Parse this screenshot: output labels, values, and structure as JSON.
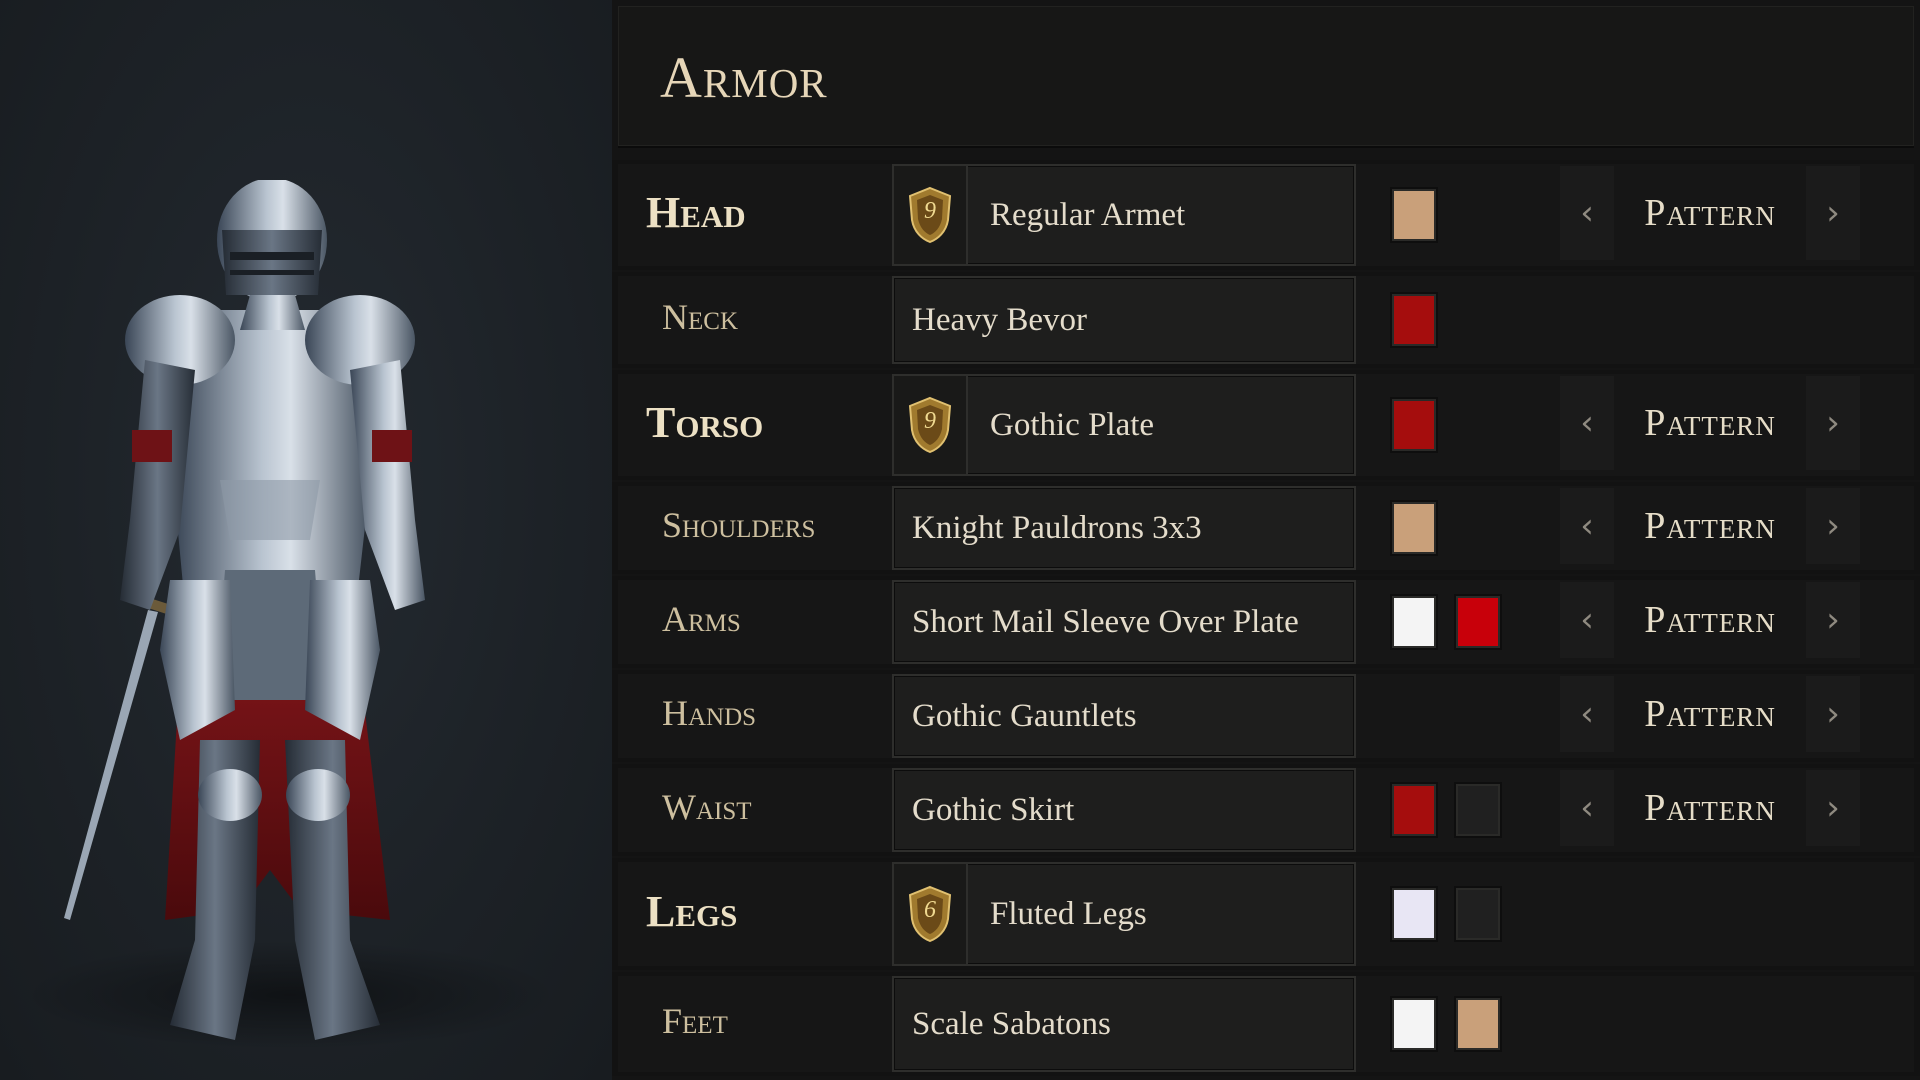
{
  "title": "Armor",
  "pattern_label": "Pattern",
  "colors": {
    "tan": "#c9a07a",
    "red": "#a50d0d",
    "bright_red": "#c8000a",
    "white": "#f4f4f4",
    "lavender_white": "#e8e6f4",
    "dark": "#202020"
  },
  "slots": [
    {
      "label": "Head",
      "major": true,
      "item": "Regular Armet",
      "badge": "9",
      "badge_icon": "shield-badge-icon",
      "swatches": [
        "tan"
      ],
      "pattern": true
    },
    {
      "label": "Neck",
      "major": false,
      "item": "Heavy Bevor",
      "badge": null,
      "swatches": [
        "red"
      ],
      "pattern": false
    },
    {
      "label": "Torso",
      "major": true,
      "item": "Gothic Plate",
      "badge": "9",
      "badge_icon": "shield-badge-icon",
      "swatches": [
        "red"
      ],
      "pattern": true
    },
    {
      "label": "Shoulders",
      "major": false,
      "item": "Knight Pauldrons 3x3",
      "badge": null,
      "swatches": [
        "tan"
      ],
      "pattern": true
    },
    {
      "label": "Arms",
      "major": false,
      "item": "Short Mail Sleeve Over Plate",
      "badge": null,
      "swatches": [
        "white",
        "bright_red"
      ],
      "pattern": true
    },
    {
      "label": "Hands",
      "major": false,
      "item": "Gothic Gauntlets",
      "badge": null,
      "swatches": [],
      "pattern": true
    },
    {
      "label": "Waist",
      "major": false,
      "item": "Gothic Skirt",
      "badge": null,
      "swatches": [
        "red",
        "dark"
      ],
      "pattern": true
    },
    {
      "label": "Legs",
      "major": true,
      "item": "Fluted Legs",
      "badge": "6",
      "badge_icon": "shield-badge-icon",
      "swatches": [
        "lavender_white",
        "dark"
      ],
      "pattern": false
    },
    {
      "label": "Feet",
      "major": false,
      "item": "Scale Sabatons",
      "badge": null,
      "swatches": [
        "white",
        "tan"
      ],
      "pattern": false
    }
  ],
  "icons": {
    "prev": "‹",
    "next": "›",
    "character": "knight-character-preview"
  }
}
